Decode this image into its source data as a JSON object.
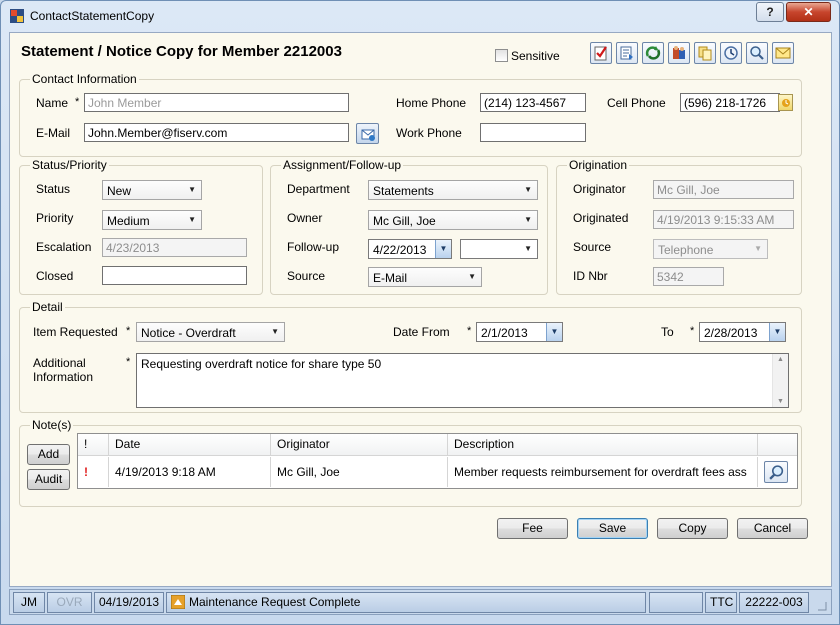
{
  "window": {
    "title": "ContactStatementCopy",
    "help_label": "?",
    "close_label": "✕"
  },
  "heading": "Statement / Notice Copy for Member 2212003",
  "sensitive_label": "Sensitive",
  "toolbar_icons": [
    "checklist-icon",
    "document-icon",
    "refresh-icon",
    "people-icon",
    "copy-icon",
    "history-icon",
    "search-icon",
    "mail-icon"
  ],
  "contact": {
    "title": "Contact Information",
    "name_label": "Name",
    "name_placeholder": "John Member",
    "email_label": "E-Mail",
    "email_value": "John.Member@fiserv.com",
    "home_phone_label": "Home Phone",
    "home_phone_value": "(214) 123-4567",
    "cell_phone_label": "Cell Phone",
    "cell_phone_value": "(596) 218-1726",
    "work_phone_label": "Work Phone",
    "work_phone_value": ""
  },
  "status": {
    "title": "Status/Priority",
    "status_label": "Status",
    "status_value": "New",
    "priority_label": "Priority",
    "priority_value": "Medium",
    "escalation_label": "Escalation",
    "escalation_value": "4/23/2013",
    "closed_label": "Closed",
    "closed_value": ""
  },
  "assignment": {
    "title": "Assignment/Follow-up",
    "department_label": "Department",
    "department_value": "Statements",
    "owner_label": "Owner",
    "owner_value": "Mc Gill, Joe",
    "followup_label": "Follow-up",
    "followup_value": "4/22/2013",
    "followup_time": "",
    "source_label": "Source",
    "source_value": "E-Mail"
  },
  "origination": {
    "title": "Origination",
    "originator_label": "Originator",
    "originator_value": "Mc Gill, Joe",
    "originated_label": "Originated",
    "originated_value": "4/19/2013 9:15:33 AM",
    "source_label": "Source",
    "source_value": "Telephone",
    "idnbr_label": "ID Nbr",
    "idnbr_value": "5342"
  },
  "detail": {
    "title": "Detail",
    "item_label": "Item Requested",
    "item_value": "Notice - Overdraft",
    "date_from_label": "Date From",
    "date_from_value": "2/1/2013",
    "to_label": "To",
    "to_value": "2/28/2013",
    "additional_label_1": "Additional",
    "additional_label_2": "Information",
    "additional_value": "Requesting overdraft notice for share type 50"
  },
  "notes": {
    "title": "Note(s)",
    "add_label": "Add",
    "audit_label": "Audit",
    "columns": [
      "!",
      "Date",
      "Originator",
      "Description"
    ],
    "rows": [
      {
        "flag": "!",
        "date": "4/19/2013 9:18 AM",
        "originator": "Mc Gill, Joe",
        "description": "Member requests reimbursement for overdraft fees ass"
      }
    ]
  },
  "buttons": {
    "fee": "Fee",
    "save": "Save",
    "copy": "Copy",
    "cancel": "Cancel"
  },
  "required_mark": "*",
  "statusbar": {
    "user": "JM",
    "ovr": "OVR",
    "date": "04/19/2013",
    "message": "Maintenance Request Complete",
    "ttc": "TTC",
    "code": "22222-003"
  }
}
